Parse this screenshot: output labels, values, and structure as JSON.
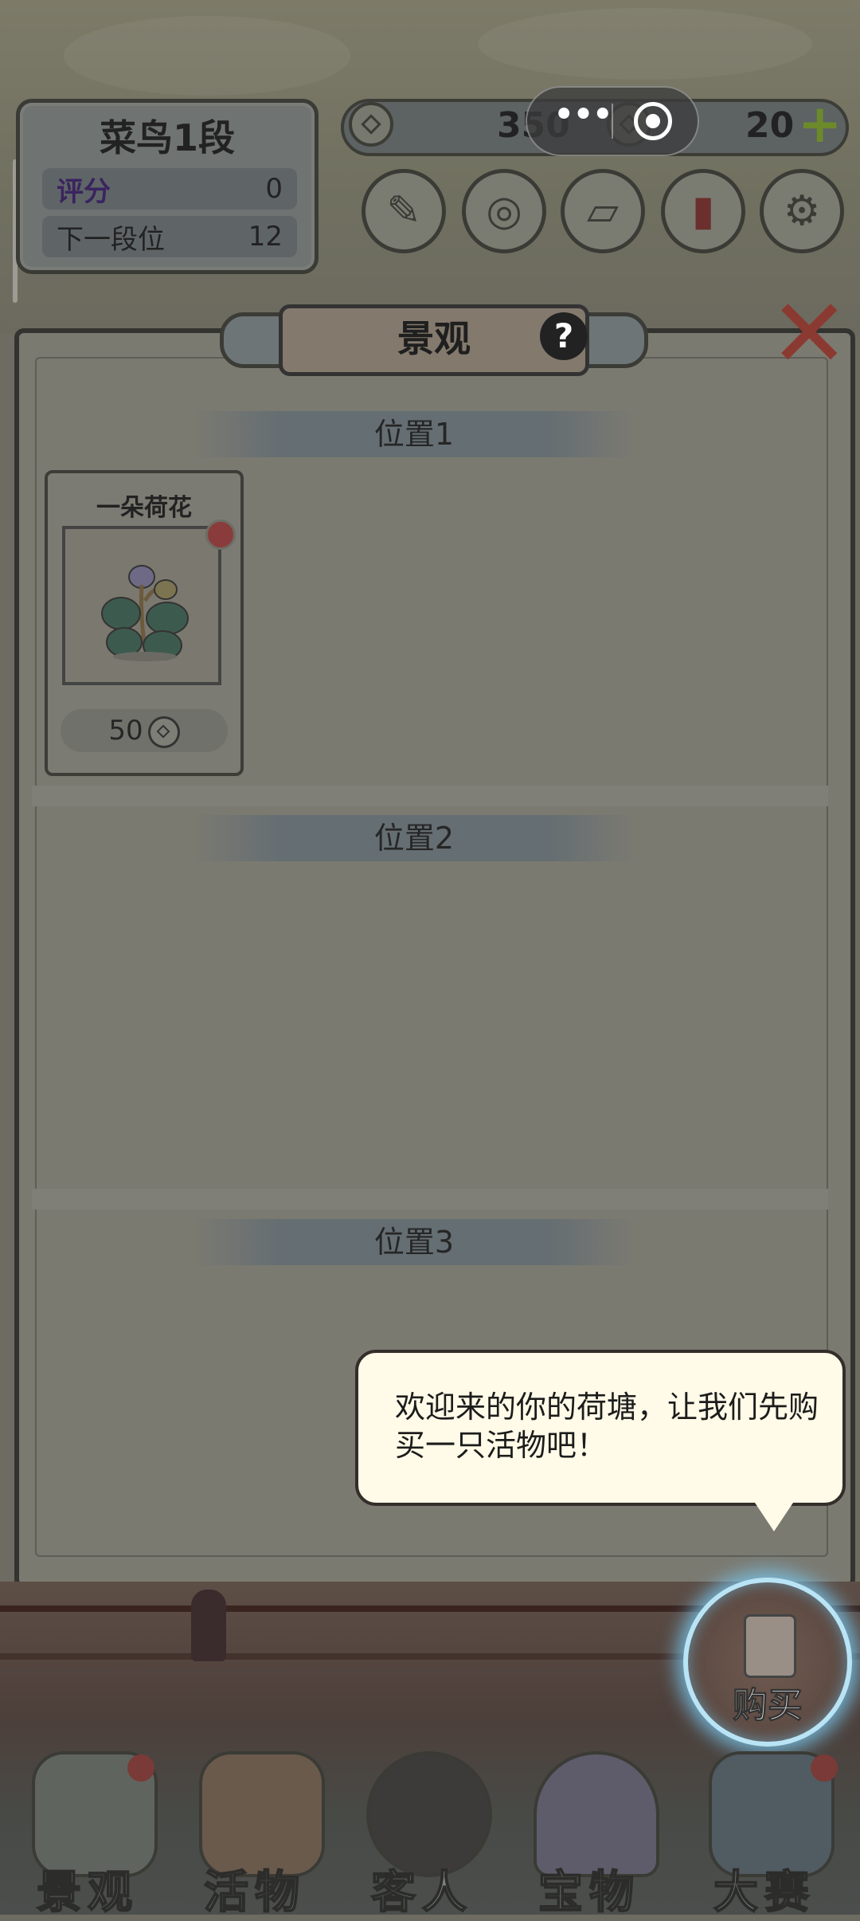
{
  "rank": {
    "title": "菜鸟1段",
    "score_label": "评分",
    "score_value": "0",
    "next_label": "下一段位",
    "next_value": "12"
  },
  "currency": {
    "coins": "350",
    "gems": "20",
    "coin_icon": "copper-coin-icon",
    "add_icon": "plus-icon"
  },
  "tools": [
    {
      "icon": "brush-scroll-icon"
    },
    {
      "icon": "gear-wheel-icon"
    },
    {
      "icon": "map-scroll-icon"
    },
    {
      "icon": "red-cards-icon"
    },
    {
      "icon": "settings-icon"
    }
  ],
  "modal": {
    "title": "景观",
    "help": "?",
    "sections": [
      {
        "label": "位置1"
      },
      {
        "label": "位置2"
      },
      {
        "label": "位置3"
      }
    ],
    "item": {
      "name": "一朵荷花",
      "price": "50",
      "icon": "lotus-icon"
    }
  },
  "bubble": {
    "text": "欢迎来的你的荷塘，让我们先购买一只活物吧！"
  },
  "buy_button": {
    "label": "购买"
  },
  "nav": [
    {
      "label": "景观",
      "icon": "rock-icon",
      "badge": true
    },
    {
      "label": "活物",
      "icon": "koi-fish-icon",
      "badge": false
    },
    {
      "label": "客人",
      "icon": "guest-icon",
      "badge": false
    },
    {
      "label": "宝物",
      "icon": "shell-icon",
      "badge": false
    },
    {
      "label": "大赛",
      "icon": "dragon-icon",
      "badge": true
    }
  ]
}
